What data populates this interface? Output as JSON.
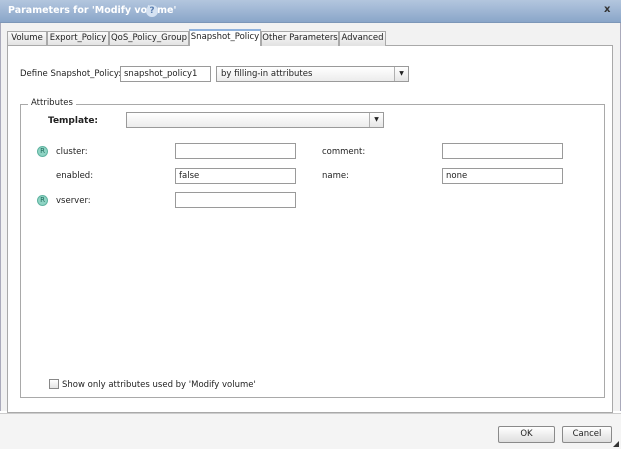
{
  "window": {
    "title": "Parameters for 'Modify volume'",
    "help_icon": "help-icon",
    "close_label": "x"
  },
  "tabs": [
    {
      "label": "Volume"
    },
    {
      "label": "Export_Policy"
    },
    {
      "label": "QoS_Policy_Group"
    },
    {
      "label": "Snapshot_Policy",
      "active": true
    },
    {
      "label": "Other Parameters"
    },
    {
      "label": "Advanced"
    }
  ],
  "define": {
    "label": "Define Snapshot_Policy:",
    "value": "snapshot_policy1",
    "mode": "by filling-in attributes"
  },
  "attributes": {
    "legend": "Attributes",
    "template_label": "Template:",
    "template_value": "",
    "fields": [
      {
        "label": "cluster:",
        "value": "",
        "required": true,
        "badge": "R"
      },
      {
        "label": "comment:",
        "value": ""
      },
      {
        "label": "enabled:",
        "value": "false"
      },
      {
        "label": "name:",
        "value": "none"
      },
      {
        "label": "vserver:",
        "value": "",
        "required": true,
        "badge": "R"
      }
    ],
    "show_only_label": "Show only attributes used by 'Modify volume'",
    "show_only_checked": false
  },
  "footer": {
    "ok": "OK",
    "cancel": "Cancel"
  }
}
